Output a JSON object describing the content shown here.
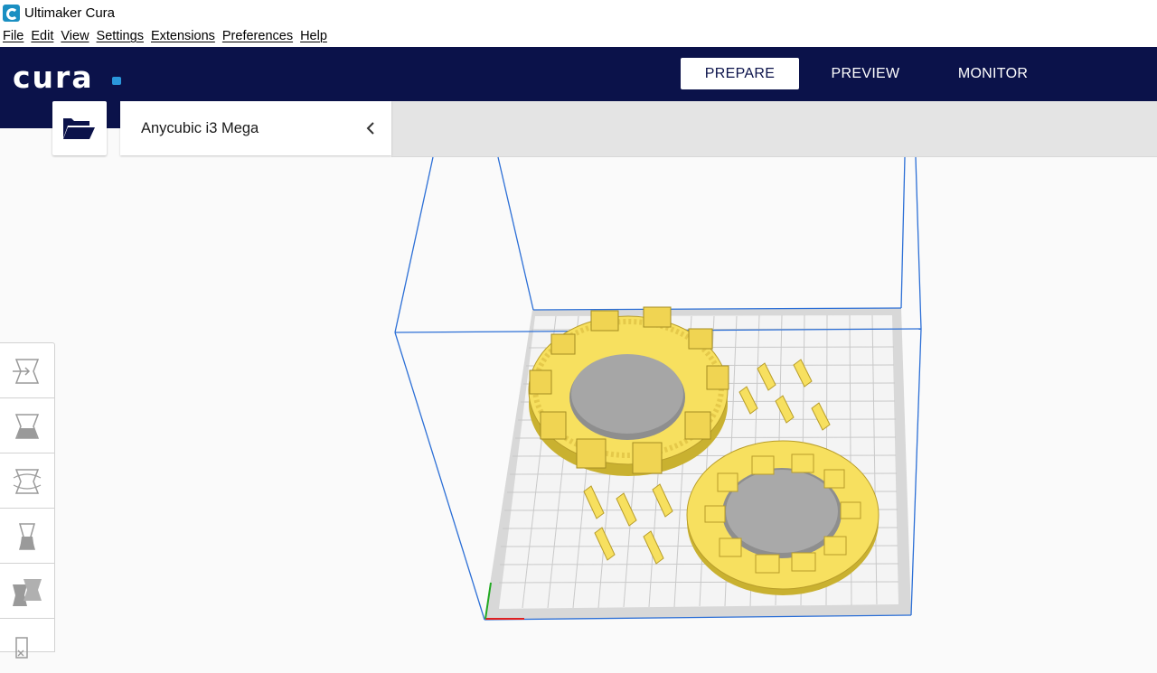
{
  "window": {
    "title": "Ultimaker Cura"
  },
  "menu": [
    {
      "label": "File"
    },
    {
      "label": "Edit"
    },
    {
      "label": "View"
    },
    {
      "label": "Settings"
    },
    {
      "label": "Extensions"
    },
    {
      "label": "Preferences"
    },
    {
      "label": "Help"
    }
  ],
  "header": {
    "logo": "cura",
    "tabs": [
      {
        "label": "PREPARE",
        "active": true
      },
      {
        "label": "PREVIEW",
        "active": false
      },
      {
        "label": "MONITOR",
        "active": false
      }
    ]
  },
  "toolbar": {
    "open_icon": "folder-open-icon",
    "printer": "Anycubic i3 Mega",
    "collapse_icon": "chevron-left-icon"
  },
  "tools": [
    {
      "icon": "move-icon"
    },
    {
      "icon": "scale-icon"
    },
    {
      "icon": "rotate-icon"
    },
    {
      "icon": "mirror-icon"
    },
    {
      "icon": "per-model-settings-icon"
    },
    {
      "icon": "support-blocker-icon"
    }
  ],
  "colors": {
    "header_bg": "#0b124a",
    "logo_dot": "#2a97db",
    "model": "#f7e05f",
    "build_volume": "#2c6fd6"
  }
}
